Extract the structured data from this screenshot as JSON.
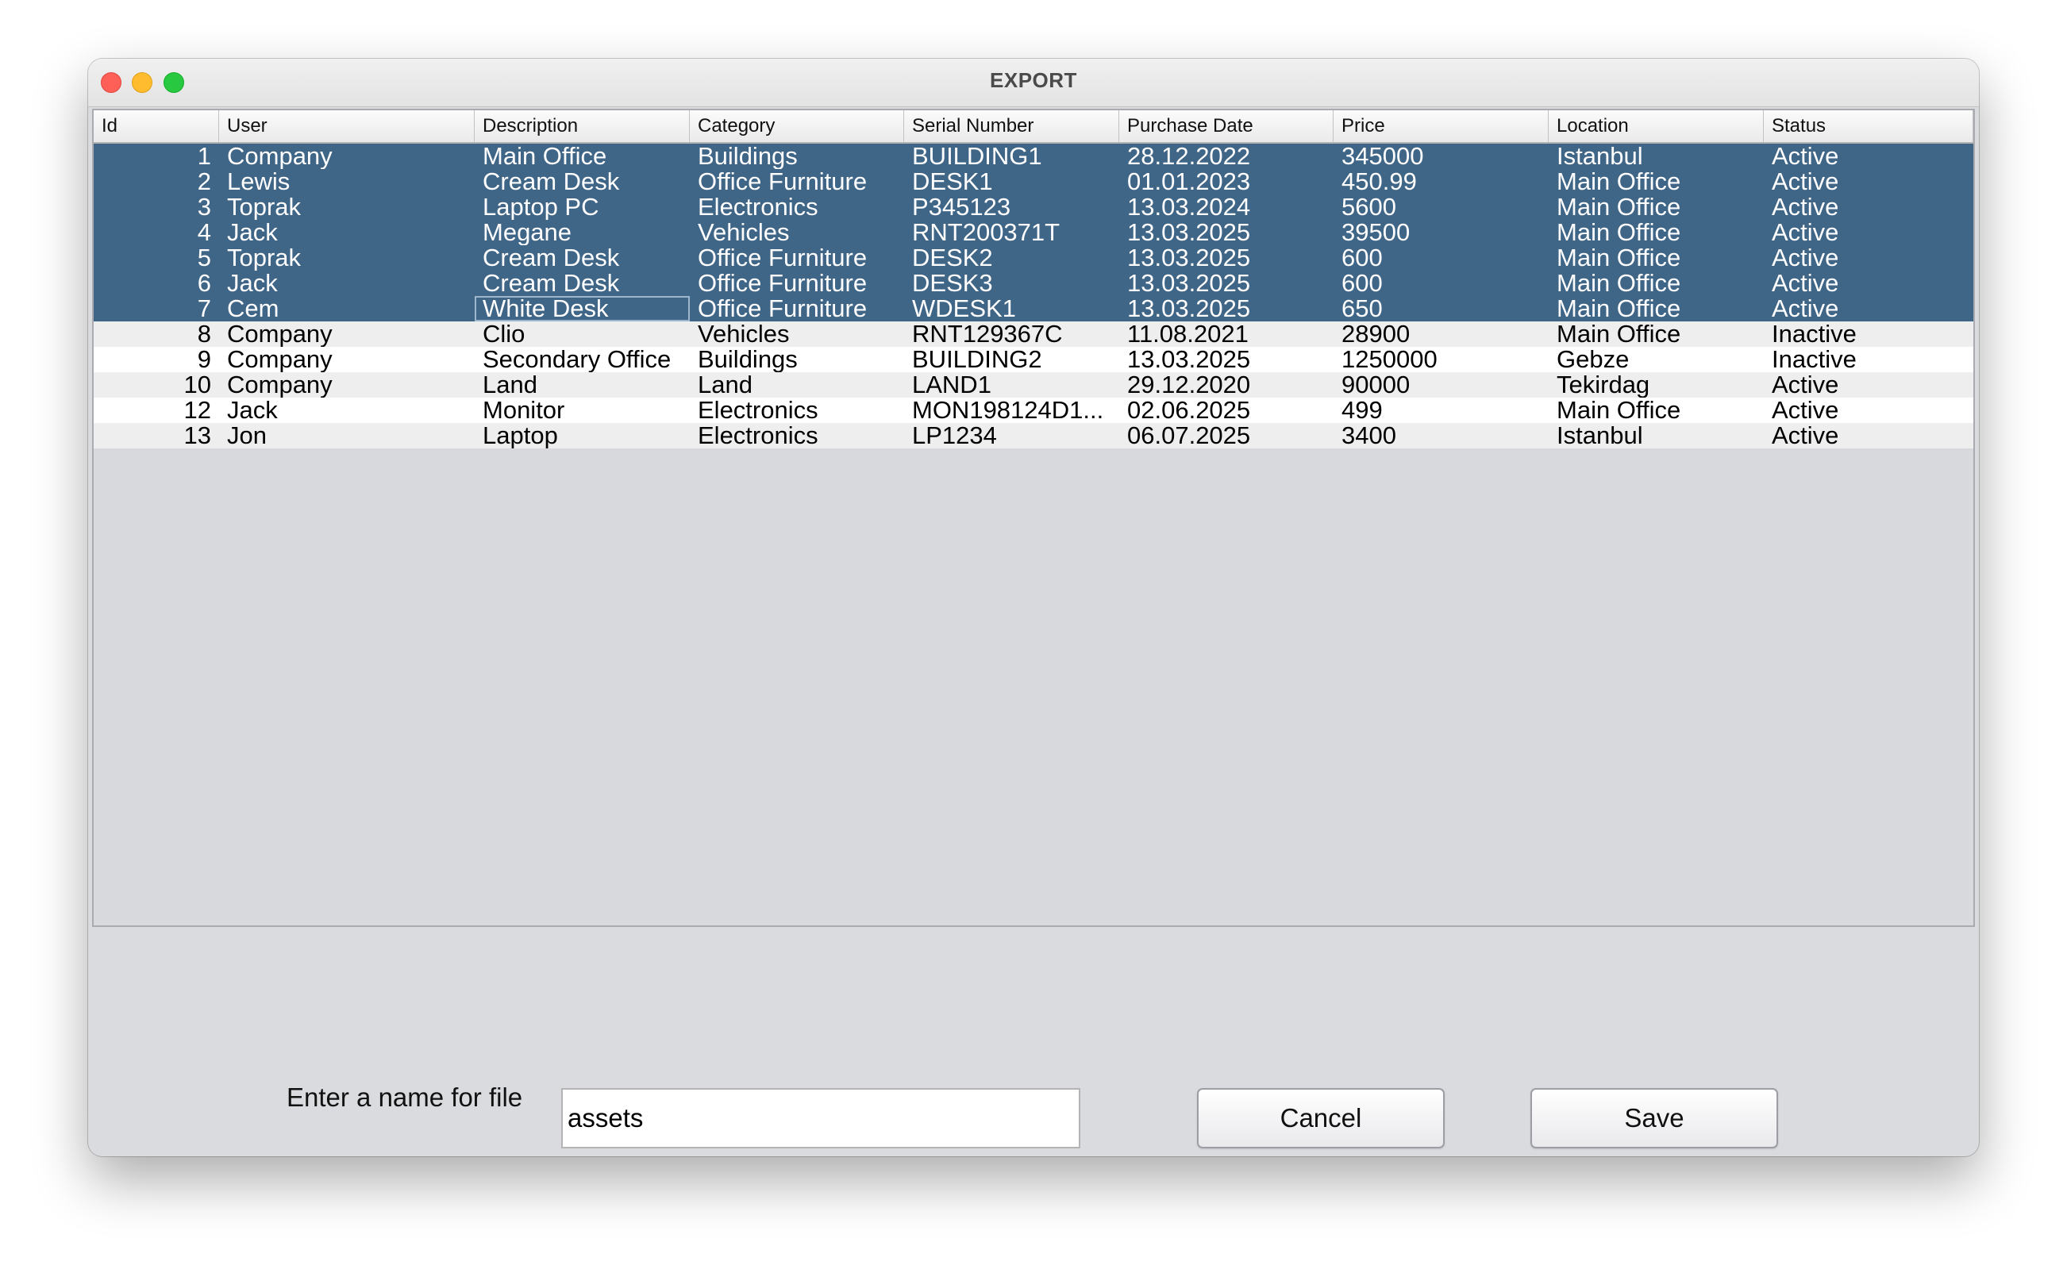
{
  "window": {
    "title": "EXPORT"
  },
  "table": {
    "columns": [
      "Id",
      "User",
      "Description",
      "Category",
      "Serial Number",
      "Purchase Date",
      "Price",
      "Location",
      "Status"
    ],
    "rows": [
      [
        "1",
        "Company",
        "Main Office",
        "Buildings",
        "BUILDING1",
        "28.12.2022",
        "345000",
        "Istanbul",
        "Active"
      ],
      [
        "2",
        "Lewis",
        "Cream Desk",
        "Office Furniture",
        "DESK1",
        "01.01.2023",
        "450.99",
        "Main Office",
        "Active"
      ],
      [
        "3",
        "Toprak",
        "Laptop PC",
        "Electronics",
        "P345123",
        "13.03.2024",
        "5600",
        "Main Office",
        "Active"
      ],
      [
        "4",
        "Jack",
        "Megane",
        "Vehicles",
        "RNT200371T",
        "13.03.2025",
        "39500",
        "Main Office",
        "Active"
      ],
      [
        "5",
        "Toprak",
        "Cream Desk",
        "Office Furniture",
        "DESK2",
        "13.03.2025",
        "600",
        "Main Office",
        "Active"
      ],
      [
        "6",
        "Jack",
        "Cream Desk",
        "Office Furniture",
        "DESK3",
        "13.03.2025",
        "600",
        "Main Office",
        "Active"
      ],
      [
        "7",
        "Cem",
        "White Desk",
        "Office Furniture",
        "WDESK1",
        "13.03.2025",
        "650",
        "Main Office",
        "Active"
      ],
      [
        "8",
        "Company",
        "Clio",
        "Vehicles",
        "RNT129367C",
        "11.08.2021",
        "28900",
        "Main Office",
        "Inactive"
      ],
      [
        "9",
        "Company",
        "Secondary Office",
        "Buildings",
        "BUILDING2",
        "13.03.2025",
        "1250000",
        "Gebze",
        "Inactive"
      ],
      [
        "10",
        "Company",
        "Land",
        "Land",
        "LAND1",
        "29.12.2020",
        "90000",
        "Tekirdag",
        "Active"
      ],
      [
        "12",
        "Jack",
        "Monitor",
        "Electronics",
        "MON198124D1...",
        "02.06.2025",
        "499",
        "Main Office",
        "Active"
      ],
      [
        "13",
        "Jon",
        "Laptop",
        "Electronics",
        "LP1234",
        "06.07.2025",
        "3400",
        "Istanbul",
        "Active"
      ]
    ],
    "selected_count": 7
  },
  "form": {
    "file_label": "Enter a name for file",
    "file_value": "assets",
    "cancel_label": "Cancel",
    "save_label": "Save"
  },
  "colors": {
    "selection": "#3f6587",
    "window_bg": "#dadbdf",
    "close": "#fe5f57",
    "minimize": "#febc2e",
    "maximize": "#28c840"
  }
}
